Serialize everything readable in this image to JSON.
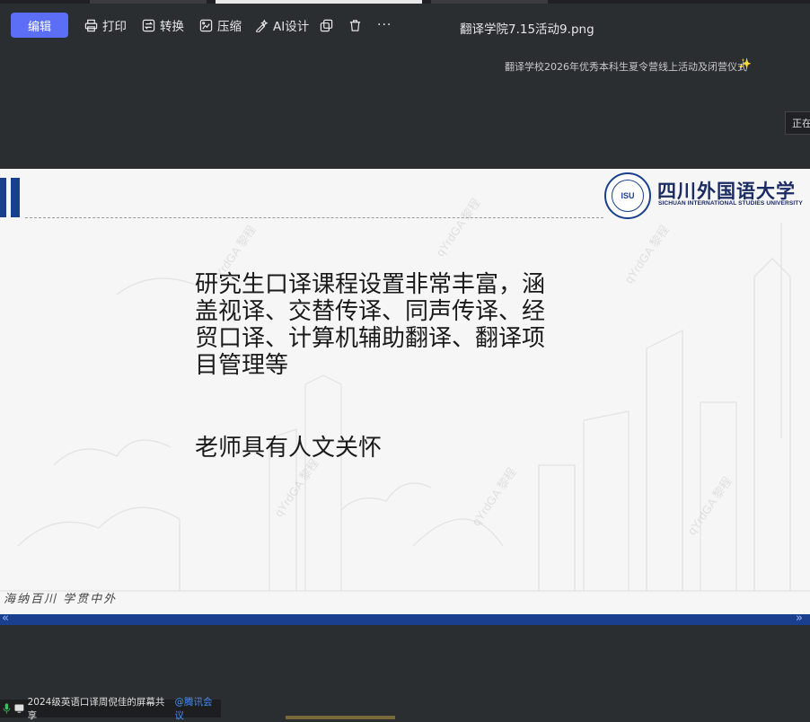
{
  "toolbar": {
    "edit_label": "编辑",
    "print_label": "打印",
    "convert_label": "转换",
    "compress_label": "压缩",
    "ai_label": "AI设计",
    "more_label": "···"
  },
  "file": {
    "title": "翻译学院7.15活动9.png"
  },
  "subtitle": {
    "text": "翻译学校2026年优秀本科生夏令营线上活动及闭营仪式"
  },
  "status": {
    "label": "正在"
  },
  "slide": {
    "logo_cn": "四川外国语大学",
    "logo_en": "SICHUAN INTERNATIONAL STUDIES UNIVERSITY",
    "logo_mark": "ISU",
    "lines": [
      "研究生口译课程设置非常丰富，涵",
      "盖视译、交替传译、同声传译、经",
      "贸口译、计算机辅助翻译、翻译项",
      "目管理等"
    ],
    "line2": "老师具有人文关怀",
    "motto": "海纳百川 学贯中外",
    "watermark": "qYrdGA 黎程"
  },
  "nav": {
    "prev": "«",
    "next": "»"
  },
  "share": {
    "text": "2024级英语口译周倪佳的屏幕共享",
    "brand": "@腾讯会议"
  },
  "colors": {
    "accent": "#5b6ef5",
    "slide_blue": "#1a3f8f"
  }
}
